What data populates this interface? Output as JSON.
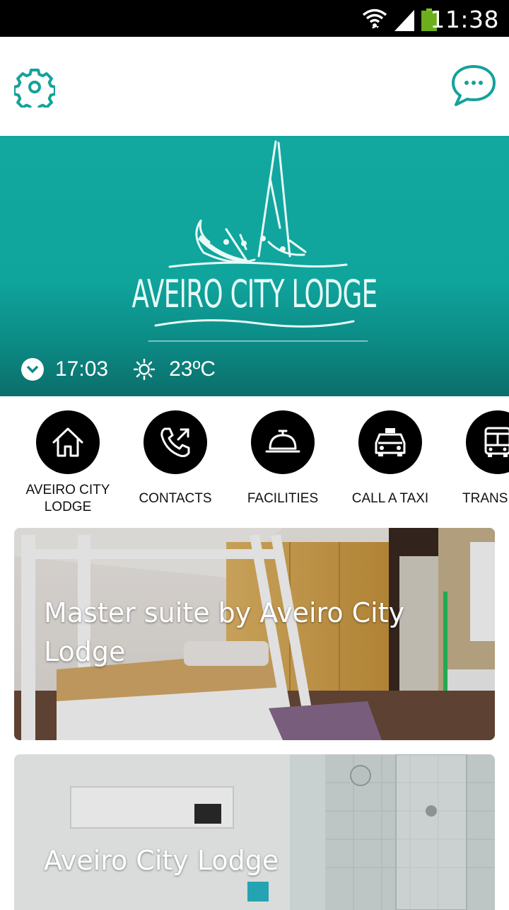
{
  "status_bar": {
    "time": "11:38",
    "icons": [
      "wifi-icon",
      "signal-icon",
      "battery-icon"
    ]
  },
  "header": {
    "settings_icon": "gear-icon",
    "chat_icon": "chat-bubble-icon"
  },
  "hero": {
    "brand_name": "AVEIRO CITY LODGE",
    "local_time": "17:03",
    "temperature": "23ºC",
    "accent_color": "#12a8a0"
  },
  "quick_actions": [
    {
      "label": "AVEIRO CITY LODGE",
      "icon": "home-icon"
    },
    {
      "label": "CONTACTS",
      "icon": "phone-outgoing-icon"
    },
    {
      "label": "FACILITIES",
      "icon": "service-bell-icon"
    },
    {
      "label": "CALL A TAXI",
      "icon": "taxi-icon"
    },
    {
      "label": "TRANS",
      "icon": "bus-icon"
    }
  ],
  "cards": [
    {
      "title": "Master suite by Aveiro City Lodge"
    },
    {
      "title": "Aveiro City Lodge"
    }
  ]
}
